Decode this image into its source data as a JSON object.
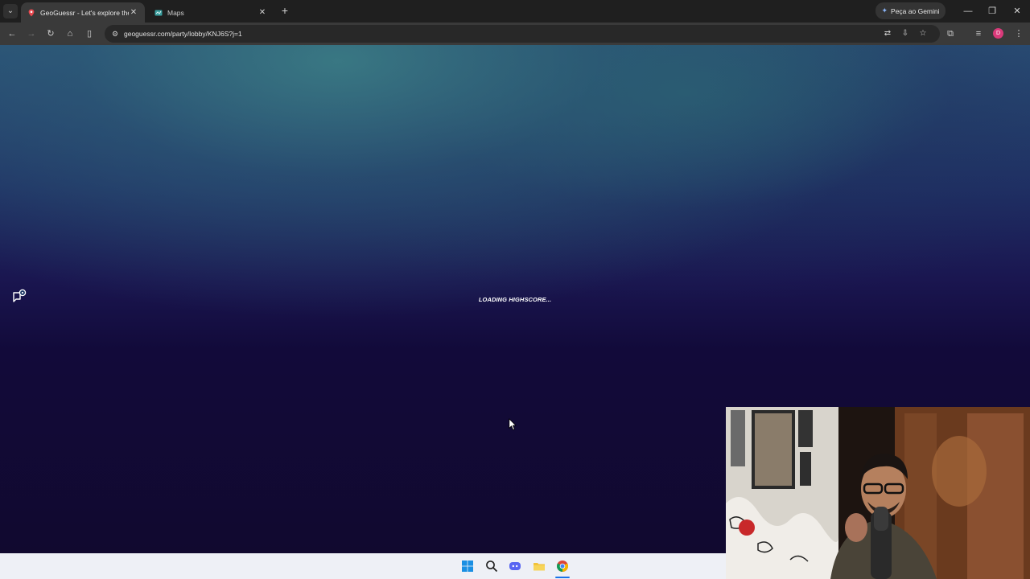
{
  "browser": {
    "tabs": [
      {
        "title": "GeoGuessr - Let's explore the w",
        "active": true
      },
      {
        "title": "Maps",
        "active": false
      }
    ],
    "gemini_label": "Peça ao Gemini",
    "profile_initial": "D",
    "url": "geoguessr.com/party/lobby/KNJ6S?j=1"
  },
  "page": {
    "status_text": "LOADING HIGHSCORE..."
  },
  "taskbar": {
    "icons": [
      "windows-start-icon",
      "search-icon",
      "discord-icon",
      "file-explorer-icon",
      "chrome-icon"
    ]
  },
  "colors": {
    "page_top": "#2a4f76",
    "page_bottom": "#11092f",
    "accent_profile": "#d93a7a"
  }
}
